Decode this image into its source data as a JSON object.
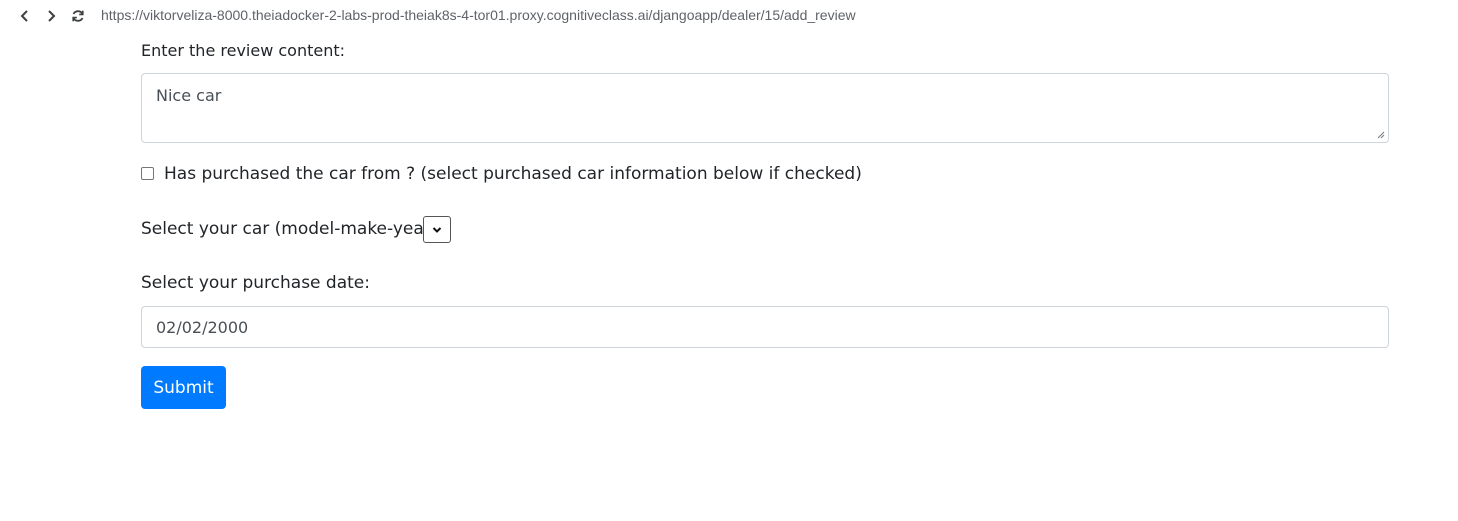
{
  "browser": {
    "url": "https://viktorveliza-8000.theiadocker-2-labs-prod-theiak8s-4-tor01.proxy.cognitiveclass.ai/djangoapp/dealer/15/add_review",
    "icons": [
      "back-icon",
      "forward-icon",
      "reload-icon"
    ]
  },
  "form": {
    "content_label": "Enter the review content:",
    "content_value": "Nice car",
    "purchase_check_label": "Has purchased the car from ? (select purchased car information below if checked)",
    "purchase_checked": false,
    "car_select_label": "Select your car (model-make-year):",
    "car_select_value": "",
    "date_label": "Select your purchase date:",
    "date_value": "02/02/2000",
    "submit_label": "Submit"
  },
  "colors": {
    "primary": "#007bff",
    "text": "#212529",
    "input_border": "#ced4da",
    "url_text": "#5f6368"
  }
}
